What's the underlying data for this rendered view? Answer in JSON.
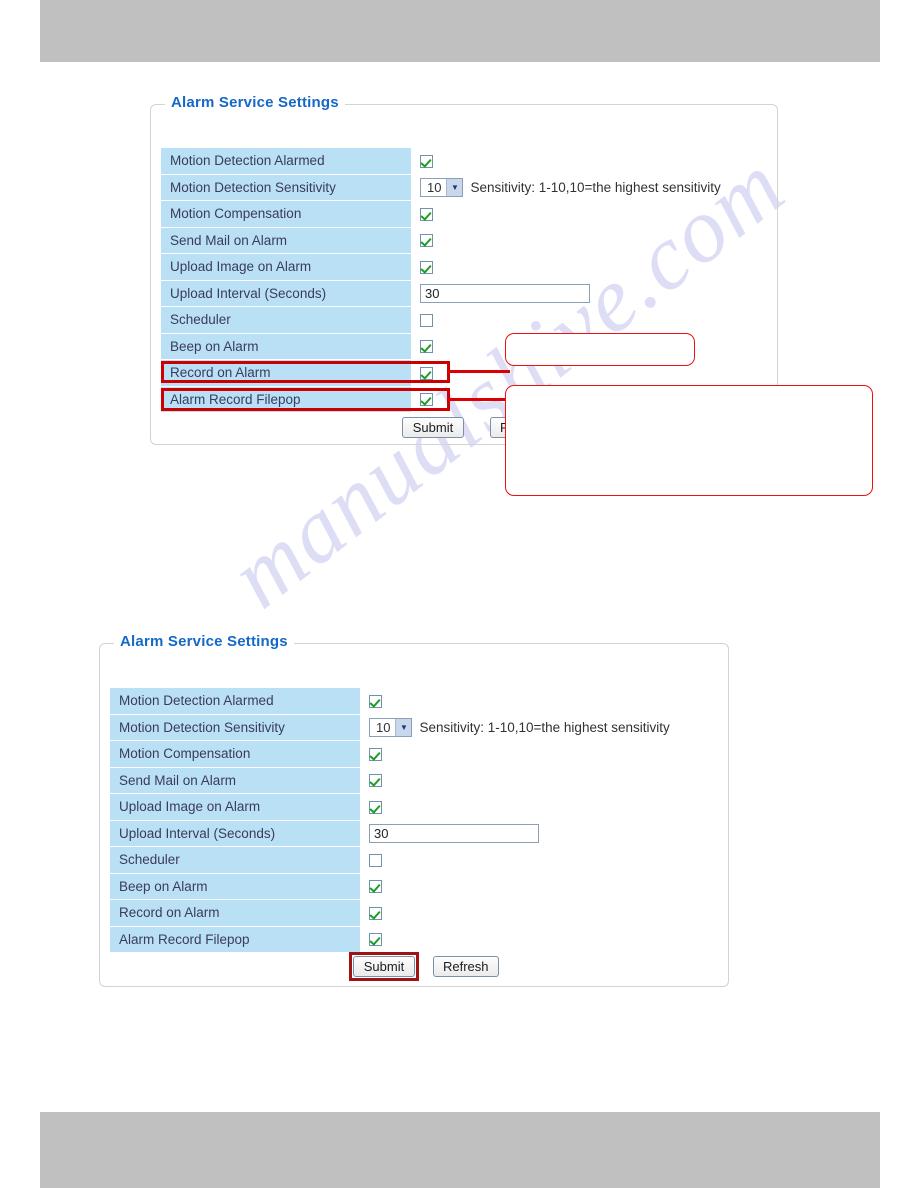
{
  "watermark": {
    "text": "manualshive.com"
  },
  "panels": [
    {
      "id": "alarm-service-settings-top",
      "legend": "Alarm Service Settings",
      "rows": [
        {
          "label": "Motion Detection Alarmed",
          "control": "checkbox",
          "checked": true
        },
        {
          "label": "Motion Detection Sensitivity",
          "control": "select",
          "value": "10",
          "hint": "Sensitivity: 1-10,10=the highest sensitivity"
        },
        {
          "label": "Motion Compensation",
          "control": "checkbox",
          "checked": true
        },
        {
          "label": "Send Mail on Alarm",
          "control": "checkbox",
          "checked": true
        },
        {
          "label": "Upload Image on Alarm",
          "control": "checkbox",
          "checked": true
        },
        {
          "label": "Upload Interval (Seconds)",
          "control": "text",
          "value": "30"
        },
        {
          "label": "Scheduler",
          "control": "checkbox",
          "checked": false
        },
        {
          "label": "Beep on Alarm",
          "control": "checkbox",
          "checked": true
        },
        {
          "label": "Record on Alarm",
          "control": "checkbox",
          "checked": true,
          "highlighted": true
        },
        {
          "label": "Alarm Record Filepop",
          "control": "checkbox",
          "checked": true,
          "highlighted": true
        }
      ],
      "buttons": {
        "submit": "Submit",
        "refresh": "Refresh"
      }
    },
    {
      "id": "alarm-service-settings-bottom",
      "legend": "Alarm Service Settings",
      "rows": [
        {
          "label": "Motion Detection Alarmed",
          "control": "checkbox",
          "checked": true
        },
        {
          "label": "Motion Detection Sensitivity",
          "control": "select",
          "value": "10",
          "hint": "Sensitivity: 1-10,10=the highest sensitivity"
        },
        {
          "label": "Motion Compensation",
          "control": "checkbox",
          "checked": true
        },
        {
          "label": "Send Mail on Alarm",
          "control": "checkbox",
          "checked": true
        },
        {
          "label": "Upload Image on Alarm",
          "control": "checkbox",
          "checked": true
        },
        {
          "label": "Upload Interval (Seconds)",
          "control": "text",
          "value": "30"
        },
        {
          "label": "Scheduler",
          "control": "checkbox",
          "checked": false
        },
        {
          "label": "Beep on Alarm",
          "control": "checkbox",
          "checked": true
        },
        {
          "label": "Record on Alarm",
          "control": "checkbox",
          "checked": true
        },
        {
          "label": "Alarm Record Filepop",
          "control": "checkbox",
          "checked": true
        }
      ],
      "buttons": {
        "submit": "Submit",
        "refresh": "Refresh"
      }
    }
  ],
  "callouts": [
    {
      "id": "callout-record-on-alarm",
      "text": ""
    },
    {
      "id": "callout-alarm-record-filepop",
      "text": ""
    }
  ],
  "colors": {
    "legend_blue": "#1569c7",
    "row_label_blue": "#b9e0f4",
    "annotation_red": "#cc0000",
    "callout_red": "#ee1111",
    "chrome_gray": "#c0c0c0",
    "check_green": "#1a9e23",
    "watermark_lavender": "#c9caf0"
  }
}
